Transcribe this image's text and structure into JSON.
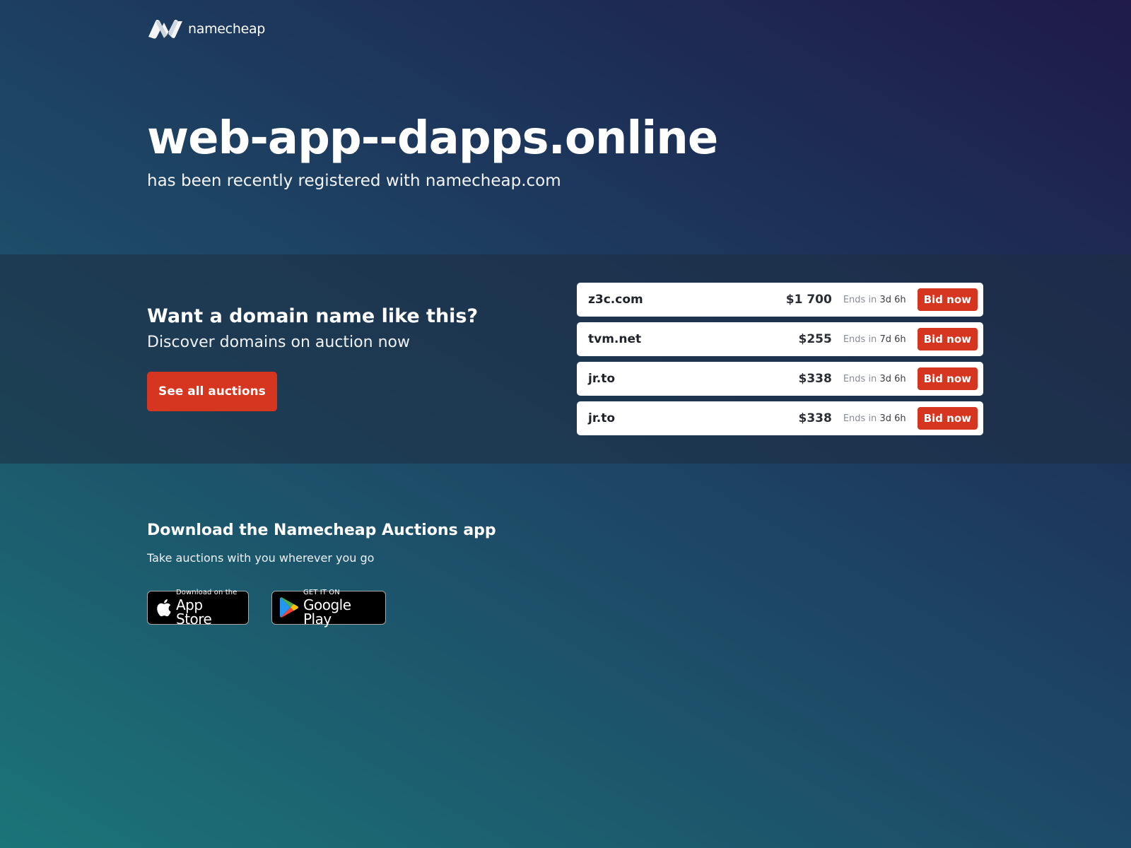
{
  "brand": {
    "name": "namecheap"
  },
  "hero": {
    "domain": "web-app--dapps.online",
    "subtitle": "has been recently registered with namecheap.com"
  },
  "auctions": {
    "title": "Want a domain name like this?",
    "subtitle": "Discover domains on auction now",
    "see_all_label": "See all auctions",
    "ends_prefix": "Ends in",
    "bid_label": "Bid now",
    "accent_color": "#d6361f",
    "rows": [
      {
        "domain": "z3c.com",
        "price": "$1 700",
        "ends": "3d 6h"
      },
      {
        "domain": "tvm.net",
        "price": "$255",
        "ends": "7d 6h"
      },
      {
        "domain": "jr.to",
        "price": "$338",
        "ends": "3d 6h"
      },
      {
        "domain": "jr.to",
        "price": "$338",
        "ends": "3d 6h"
      }
    ]
  },
  "app": {
    "title": "Download the Namecheap Auctions app",
    "subtitle": "Take auctions with you wherever you go",
    "appstore": {
      "small": "Download on the",
      "big": "App Store",
      "icon": "apple-icon"
    },
    "googleplay": {
      "small": "GET IT ON",
      "big": "Google Play",
      "icon": "google-play-icon"
    }
  }
}
